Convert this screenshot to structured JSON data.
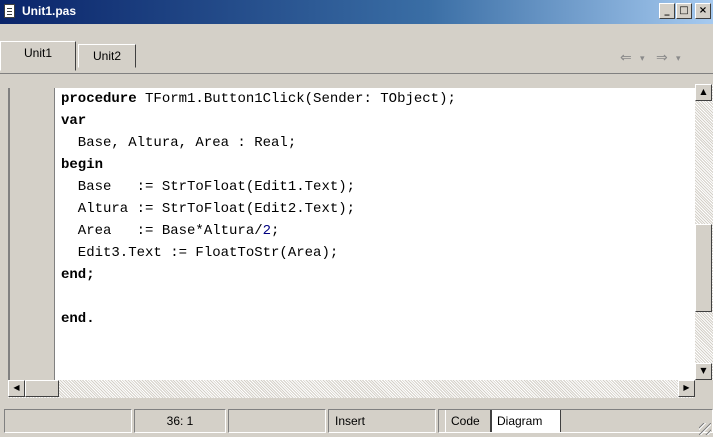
{
  "window": {
    "title": "Unit1.pas",
    "controls": {
      "minimize": "_",
      "maximize": "□",
      "close": "×"
    }
  },
  "tabs": [
    {
      "label": "Unit1",
      "active": true
    },
    {
      "label": "Unit2",
      "active": false
    }
  ],
  "nav": {
    "back": "⇐",
    "back_menu": "▾",
    "forward": "⇒",
    "forward_menu": "▾"
  },
  "code_lines": [
    {
      "text": "procedure TForm1.Button1Click(Sender: TObject);"
    },
    {
      "text": "var"
    },
    {
      "text": "  Base, Altura, Area : Real;"
    },
    {
      "text": "begin"
    },
    {
      "text": "  Base   := StrToFloat(Edit1.Text);"
    },
    {
      "text": "  Altura := StrToFloat(Edit2.Text);"
    },
    {
      "text": "  Area   := Base*Altura/2;"
    },
    {
      "text": "  Edit3.Text := FloatToStr(Area);"
    },
    {
      "text": "end;"
    },
    {
      "text": ""
    },
    {
      "text": "end."
    }
  ],
  "status": {
    "position": "36:  1",
    "mode": "Insert",
    "view_tabs": [
      {
        "label": "Code",
        "active": true
      },
      {
        "label": "Diagram",
        "active": false
      }
    ]
  },
  "scrollbar": {
    "up": "▲",
    "down": "▼",
    "left": "◀",
    "right": "▶"
  }
}
